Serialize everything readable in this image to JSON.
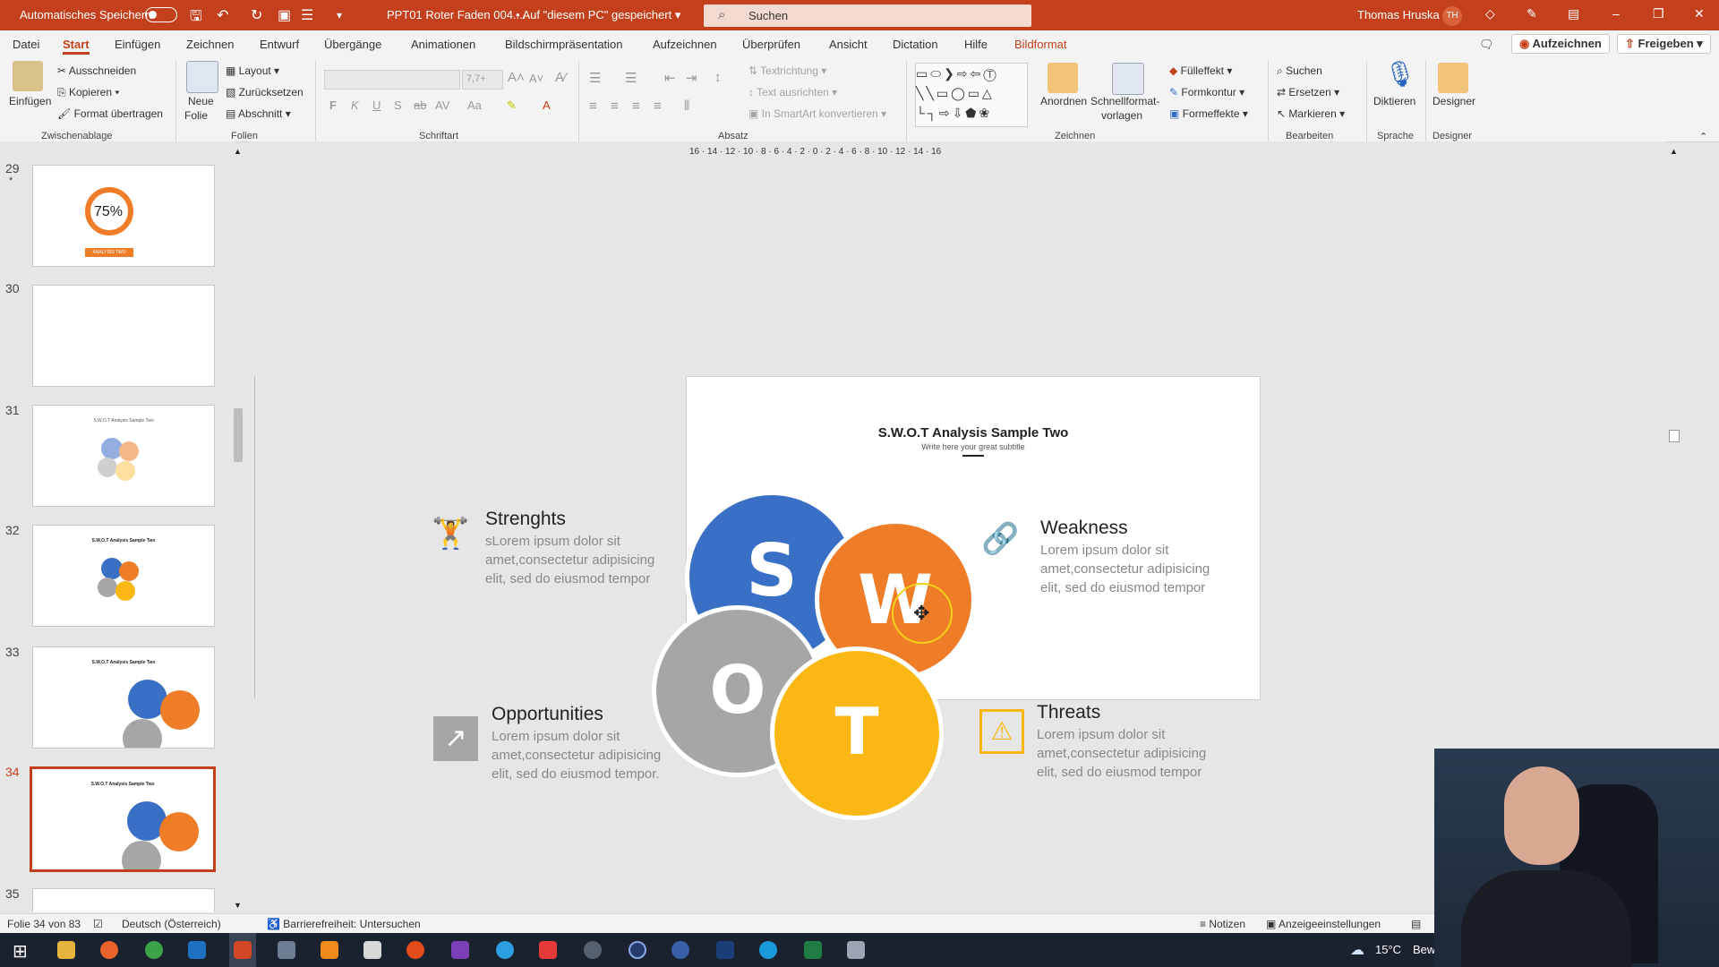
{
  "titlebar": {
    "autosave_label": "Automatisches Speichern",
    "doc_title": "PPT01 Roter Faden 004....",
    "save_status": "Auf \"diesem PC\" gespeichert",
    "search_placeholder": "Suchen",
    "user_name": "Thomas Hruska",
    "user_initials": "TH"
  },
  "menu": {
    "tabs": [
      "Datei",
      "Start",
      "Einfügen",
      "Zeichnen",
      "Entwurf",
      "Übergänge",
      "Animationen",
      "Bildschirmpräsentation",
      "Aufzeichnen",
      "Überprüfen",
      "Ansicht",
      "Dictation",
      "Hilfe",
      "Bildformat"
    ],
    "record_button": "Aufzeichnen",
    "share_button": "Freigeben"
  },
  "ribbon": {
    "clipboard": {
      "paste": "Einfügen",
      "cut": "Ausschneiden",
      "copy": "Kopieren",
      "format_painter": "Format übertragen",
      "group": "Zwischenablage"
    },
    "slides": {
      "new_slide_1": "Neue",
      "new_slide_2": "Folie",
      "layout": "Layout",
      "reset": "Zurücksetzen",
      "section": "Abschnitt",
      "group": "Folien"
    },
    "font": {
      "group": "Schriftart",
      "size": "7,7+"
    },
    "paragraph": {
      "text_direction": "Textrichtung",
      "align_text": "Text ausrichten",
      "smartart": "In SmartArt konvertieren",
      "group": "Absatz"
    },
    "drawing": {
      "arrange": "Anordnen",
      "quick_styles_1": "Schnellformat-",
      "quick_styles_2": "vorlagen",
      "fill": "Fülleffekt",
      "outline": "Formkontur",
      "effects": "Formeffekte",
      "group": "Zeichnen"
    },
    "editing": {
      "find": "Suchen",
      "replace": "Ersetzen",
      "select": "Markieren",
      "group": "Bearbeiten"
    },
    "voice": {
      "dictate": "Diktieren",
      "group": "Sprache"
    },
    "designer": {
      "label": "Designer",
      "group": "Designer"
    }
  },
  "slides_panel": [
    {
      "num": "29",
      "star": "*",
      "percent": "75%",
      "tag": "ANALYSIS TWO"
    },
    {
      "num": "30"
    },
    {
      "num": "31",
      "title": "S.W.O.T Analysis Sample Two"
    },
    {
      "num": "32",
      "title": "S.W.O.T Analysis Sample Two"
    },
    {
      "num": "33",
      "title": "S.W.O.T Analysis Sample Two"
    },
    {
      "num": "34",
      "title": "S.W.O.T Analysis Sample Two",
      "active": true
    },
    {
      "num": "35"
    }
  ],
  "slide": {
    "title": "S.W.O.T Analysis Sample Two",
    "subtitle": "Write here your great subtitle",
    "letters": {
      "s": "S",
      "w": "W",
      "o": "O",
      "t": "T"
    },
    "colors": {
      "s": "#3a6fc6",
      "w": "#ef7d28",
      "o": "#a6a6a6",
      "t": "#fbb814"
    },
    "strengths": {
      "heading": "Strenghts",
      "body": "sLorem ipsum dolor sit amet,consectetur adipisicing elit, sed do eiusmod tempor"
    },
    "weakness": {
      "heading": "Weakness",
      "body": "Lorem ipsum dolor sit amet,consectetur adipisicing elit, sed do eiusmod tempor"
    },
    "opportunities": {
      "heading": "Opportunities",
      "body": "Lorem ipsum dolor sit amet,consectetur adipisicing elit, sed do eiusmod tempor."
    },
    "threats": {
      "heading": "Threats",
      "body": "Lorem ipsum dolor sit amet,consectetur adipisicing elit, sed do eiusmod tempor"
    }
  },
  "ruler_labels": "16 · 14 · 12 · 10 · 8 · 6 · 4 · 2 · 0 · 2 · 4 · 6 · 8 · 10 · 12 · 14 · 16",
  "statusbar": {
    "slide_count": "Folie 34 von 83",
    "language": "Deutsch (Österreich)",
    "accessibility": "Barrierefreiheit: Untersuchen",
    "notes": "Notizen",
    "display_settings": "Anzeigeeinstellungen"
  },
  "taskbar": {
    "weather": "15°C",
    "weather_text": "Bew"
  },
  "accent_color": "#c4401c"
}
